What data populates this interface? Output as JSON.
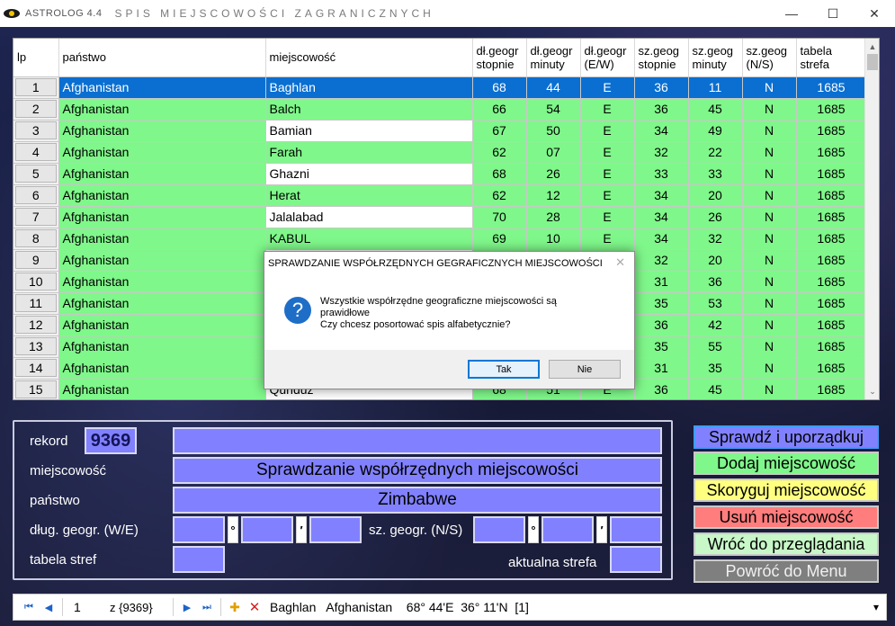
{
  "window": {
    "app_label": "ASTROLOG 4.4",
    "title": "SPIS MIEJSCOWOŚCI ZAGRANICZNYCH",
    "minimize": "—",
    "maximize": "☐",
    "close": "✕"
  },
  "grid": {
    "headers": [
      "lp",
      "państwo",
      "miejscowość",
      "dł.geogr stopnie",
      "dł.geogr minuty",
      "dł.geogr (E/W)",
      "sz.geog stopnie",
      "sz.geog minuty",
      "sz.geog (N/S)",
      "tabela strefa"
    ],
    "header_lines": [
      [
        "lp",
        ""
      ],
      [
        "państwo",
        ""
      ],
      [
        "miejscowość",
        ""
      ],
      [
        "dł.geogr",
        "stopnie"
      ],
      [
        "dł.geogr",
        "minuty"
      ],
      [
        "dł.geogr",
        "(E/W)"
      ],
      [
        "sz.geog",
        "stopnie"
      ],
      [
        "sz.geog",
        "minuty"
      ],
      [
        "sz.geog",
        "(N/S)"
      ],
      [
        "tabela",
        "strefa"
      ]
    ],
    "rows": [
      {
        "lp": "1",
        "country": "Afghanistan",
        "city": "Baghlan",
        "lon_deg": "68",
        "lon_min": "44",
        "ew": "E",
        "lat_deg": "36",
        "lat_min": "11",
        "ns": "N",
        "zone": "1685"
      },
      {
        "lp": "2",
        "country": "Afghanistan",
        "city": "Balch",
        "lon_deg": "66",
        "lon_min": "54",
        "ew": "E",
        "lat_deg": "36",
        "lat_min": "45",
        "ns": "N",
        "zone": "1685"
      },
      {
        "lp": "3",
        "country": "Afghanistan",
        "city": "Bamian",
        "lon_deg": "67",
        "lon_min": "50",
        "ew": "E",
        "lat_deg": "34",
        "lat_min": "49",
        "ns": "N",
        "zone": "1685"
      },
      {
        "lp": "4",
        "country": "Afghanistan",
        "city": "Farah",
        "lon_deg": "62",
        "lon_min": "07",
        "ew": "E",
        "lat_deg": "32",
        "lat_min": "22",
        "ns": "N",
        "zone": "1685"
      },
      {
        "lp": "5",
        "country": "Afghanistan",
        "city": "Ghazni",
        "lon_deg": "68",
        "lon_min": "26",
        "ew": "E",
        "lat_deg": "33",
        "lat_min": "33",
        "ns": "N",
        "zone": "1685"
      },
      {
        "lp": "6",
        "country": "Afghanistan",
        "city": "Herat",
        "lon_deg": "62",
        "lon_min": "12",
        "ew": "E",
        "lat_deg": "34",
        "lat_min": "20",
        "ns": "N",
        "zone": "1685"
      },
      {
        "lp": "7",
        "country": "Afghanistan",
        "city": "Jalalabad",
        "lon_deg": "70",
        "lon_min": "28",
        "ew": "E",
        "lat_deg": "34",
        "lat_min": "26",
        "ns": "N",
        "zone": "1685"
      },
      {
        "lp": "8",
        "country": "Afghanistan",
        "city": "KABUL",
        "lon_deg": "69",
        "lon_min": "10",
        "ew": "E",
        "lat_deg": "34",
        "lat_min": "32",
        "ns": "N",
        "zone": "1685"
      },
      {
        "lp": "9",
        "country": "Afghanistan",
        "city": "",
        "lon_deg": "",
        "lon_min": "",
        "ew": "",
        "lat_deg": "32",
        "lat_min": "20",
        "ns": "N",
        "zone": "1685"
      },
      {
        "lp": "10",
        "country": "Afghanistan",
        "city": "",
        "lon_deg": "",
        "lon_min": "",
        "ew": "",
        "lat_deg": "31",
        "lat_min": "36",
        "ns": "N",
        "zone": "1685"
      },
      {
        "lp": "11",
        "country": "Afghanistan",
        "city": "",
        "lon_deg": "",
        "lon_min": "",
        "ew": "",
        "lat_deg": "35",
        "lat_min": "53",
        "ns": "N",
        "zone": "1685"
      },
      {
        "lp": "12",
        "country": "Afghanistan",
        "city": "",
        "lon_deg": "",
        "lon_min": "",
        "ew": "",
        "lat_deg": "36",
        "lat_min": "42",
        "ns": "N",
        "zone": "1685"
      },
      {
        "lp": "13",
        "country": "Afghanistan",
        "city": "",
        "lon_deg": "",
        "lon_min": "",
        "ew": "",
        "lat_deg": "35",
        "lat_min": "55",
        "ns": "N",
        "zone": "1685"
      },
      {
        "lp": "14",
        "country": "Afghanistan",
        "city": "",
        "lon_deg": "",
        "lon_min": "",
        "ew": "",
        "lat_deg": "31",
        "lat_min": "35",
        "ns": "N",
        "zone": "1685"
      },
      {
        "lp": "15",
        "country": "Afghanistan",
        "city": "Qunduz",
        "lon_deg": "68",
        "lon_min": "51",
        "ew": "E",
        "lat_deg": "36",
        "lat_min": "45",
        "ns": "N",
        "zone": "1685"
      }
    ],
    "colors": {
      "selected": "#0a6fd1",
      "green": "#7ff78a",
      "white": "#ffffff"
    }
  },
  "form": {
    "rekord_label": "rekord",
    "rekord_value": "9369",
    "rekord_extra": "",
    "miejscowosc_label": "miejscowość",
    "miejscowosc_value": "Sprawdzanie współrzędnych miejscowości",
    "panstwo_label": "państwo",
    "panstwo_value": "Zimbabwe",
    "dlug_label": "dług. geogr. (W/E)",
    "sz_label": "sz. geogr. (N/S)",
    "deg_symbol": "°",
    "min_symbol": "′",
    "tabela_label": "tabela stref",
    "strefa_label": "aktualna strefa",
    "box_color": "#8181ff"
  },
  "actions": [
    {
      "label": "Sprawdź i uporządkuj",
      "color": "#8181ff"
    },
    {
      "label": "Dodaj miejscowość",
      "color": "#7ff78a"
    },
    {
      "label": "Skoryguj miejscowość",
      "color": "#ffff80"
    },
    {
      "label": "Usuń miejscowość",
      "color": "#ff7d7d"
    },
    {
      "label": "Wróć do przeglądania",
      "color": "#c8f7c8"
    },
    {
      "label": "Powróć do Menu",
      "color": "#7f7f7f"
    }
  ],
  "dialog": {
    "title": "SPRAWDZANIE WSPÓŁRZĘDNYCH GEGRAFICZNYCH MIEJSCOWOŚCI",
    "close": "✕",
    "icon": "?",
    "line1": "Wszystkie współrzędne geograficzne miejscowości są",
    "line2": "prawidłowe",
    "line3": "Czy chcesz posortować spis alfabetycznie?",
    "yes": "Tak",
    "no": "Nie"
  },
  "navigator": {
    "first": "⏮",
    "prev": "◀",
    "position": "1",
    "of": "z {9369}",
    "next": "▶",
    "last": "⏭",
    "add": "✚",
    "delete": "✕",
    "status": "Baghlan   Afghanistan    68° 44'E  36° 11'N  [1]",
    "dropdown": "▾"
  }
}
